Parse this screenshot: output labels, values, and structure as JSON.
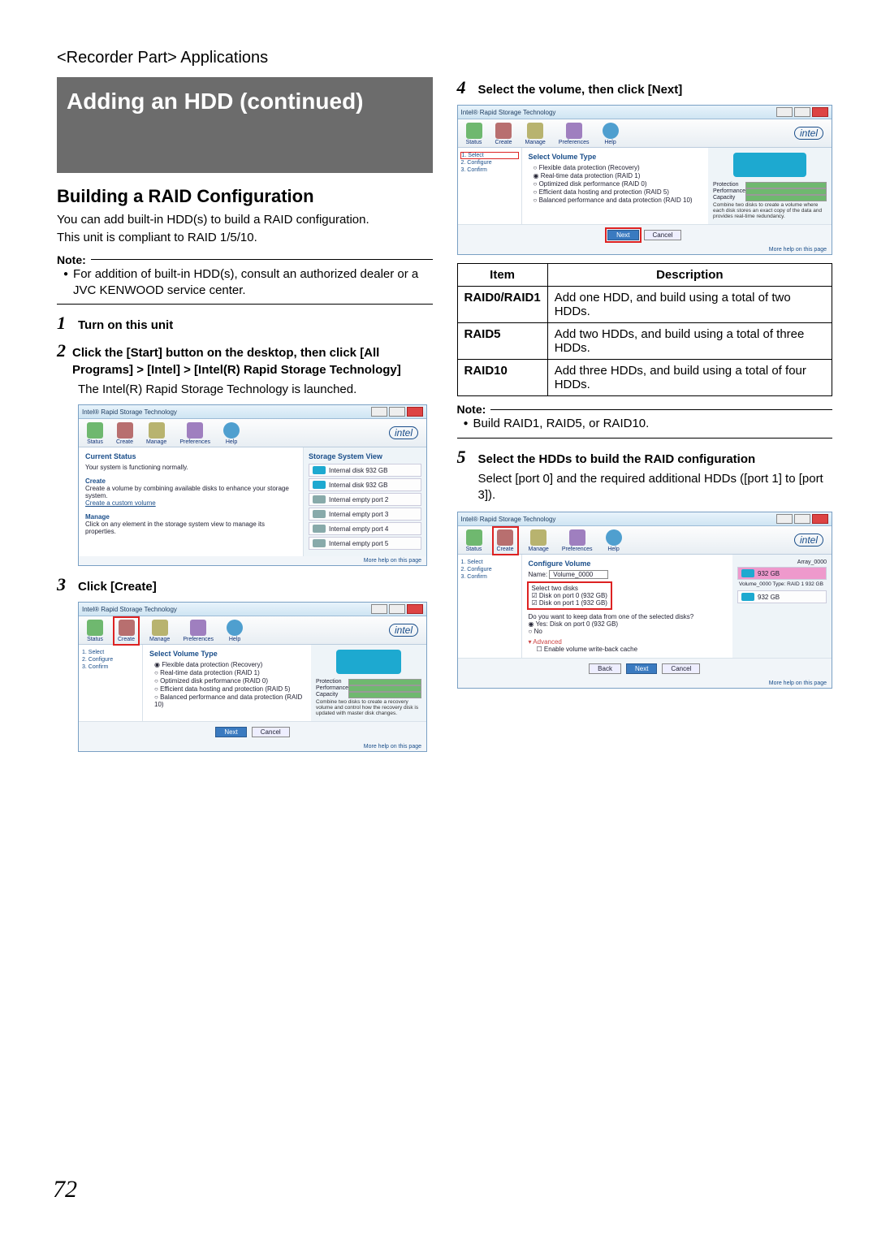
{
  "breadcrumb": "<Recorder Part> Applications",
  "title": "Adding an HDD (continued)",
  "section_heading": "Building a RAID Configuration",
  "intro1": "You can add built-in HDD(s) to build a RAID configuration.",
  "intro2": "This unit is compliant to RAID 1/5/10.",
  "note_label": "Note:",
  "note_bullet1": "For addition of built-in HDD(s), consult an authorized dealer or a JVC KENWOOD service center.",
  "steps": {
    "s1": {
      "num": "1",
      "text": "Turn on this unit"
    },
    "s2": {
      "num": "2",
      "text": "Click the [Start] button on the desktop, then click [All Programs] > [Intel] > [Intel(R) Rapid Storage Technology]",
      "body": "The Intel(R) Rapid Storage Technology is launched."
    },
    "s3": {
      "num": "3",
      "text": "Click [Create]"
    },
    "s4": {
      "num": "4",
      "text": "Select the volume, then click [Next]"
    },
    "s5": {
      "num": "5",
      "text": "Select the HDDs to build the RAID configuration",
      "body": "Select [port 0] and the required additional HDDs ([port 1] to [port 3])."
    }
  },
  "app": {
    "window_title": "Intel® Rapid Storage Technology",
    "tools": {
      "status": "Status",
      "create": "Create",
      "manage": "Manage",
      "preferences": "Preferences",
      "help": "Help"
    },
    "intel": "intel",
    "help_link": "More help on this page",
    "buttons": {
      "next": "Next",
      "back": "Back",
      "cancel": "Cancel"
    },
    "status_pane": {
      "heading": "Current Status",
      "line": "Your system is functioning normally.",
      "create_h": "Create",
      "create_line": "Create a volume by combining available disks to enhance your storage system.",
      "create_link": "Create a custom volume",
      "manage_h": "Manage",
      "manage_line": "Click on any element in the storage system view to manage its properties.",
      "view_h": "Storage System View",
      "disks": [
        "Internal disk 932 GB",
        "Internal disk 932 GB",
        "Internal empty port 2",
        "Internal empty port 3",
        "Internal empty port 4",
        "Internal empty port 5"
      ]
    },
    "wizard_side": {
      "s1": "1. Select",
      "s2": "2. Configure",
      "s3": "3. Confirm"
    },
    "select_vol": {
      "heading": "Select Volume Type",
      "opts": [
        "Flexible data protection (Recovery)",
        "Real-time data protection (RAID 1)",
        "Optimized disk performance (RAID 0)",
        "Efficient data hosting and protection (RAID 5)",
        "Balanced performance and data protection (RAID 10)"
      ],
      "bars": {
        "prot": "Protection",
        "perf": "Performance",
        "cap": "Capacity"
      },
      "desc1": "Combine two disks to create a recovery volume and control how the recovery disk is updated with master disk changes.",
      "desc2": "Combine two disks to create a volume where each disk stores an exact copy of the data and provides real-time redundancy."
    },
    "config_vol": {
      "heading": "Configure Volume",
      "name_label": "Name:",
      "name_value": "Volume_0000",
      "select_disks": "Select two disks",
      "d0": "Disk on port 0 (932 GB)",
      "d1": "Disk on port 1 (932 GB)",
      "keepq": "Do you want to keep data from one of the selected disks?",
      "yes": "Yes: Disk on port 0 (932 GB)",
      "no": "No",
      "adv": "Advanced",
      "advline": "Enable volume write-back cache",
      "array_label": "Array_0000",
      "vol_info": "Volume_0000 Type: RAID 1 932 GB",
      "disk_short": "932 GB"
    }
  },
  "raid_table": {
    "h_item": "Item",
    "h_desc": "Description",
    "rows": [
      {
        "k": "RAID0/RAID1",
        "v": "Add one HDD, and build using a total of two HDDs."
      },
      {
        "k": "RAID5",
        "v": "Add two HDDs, and build using a total of three HDDs."
      },
      {
        "k": "RAID10",
        "v": "Add three HDDs, and build using a total of four HDDs."
      }
    ]
  },
  "note2_bullet": "Build RAID1, RAID5, or RAID10.",
  "page_number": "72"
}
